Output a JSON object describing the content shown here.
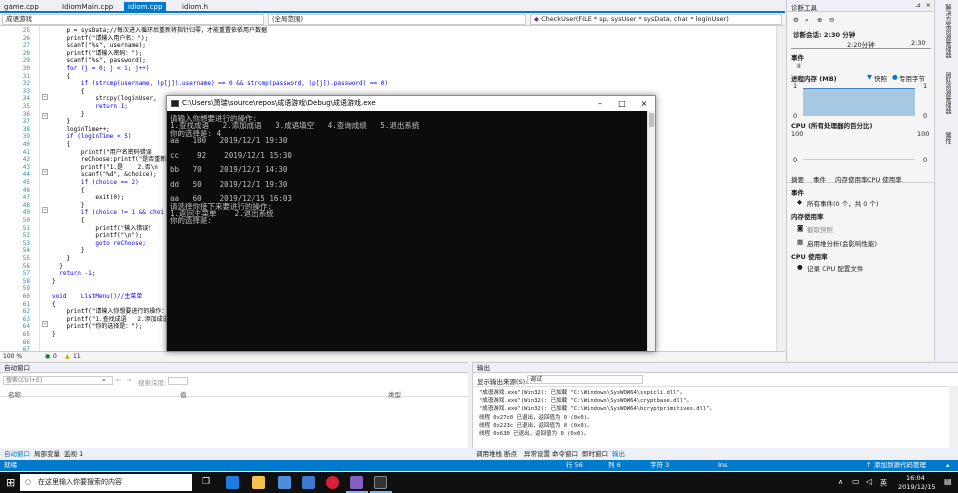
{
  "tabs": [
    {
      "label": "game.cpp"
    },
    {
      "label": "IdiomMain.cpp"
    },
    {
      "label": "idiom.cpp",
      "active": true
    },
    {
      "label": "idiom.h"
    }
  ],
  "nav": {
    "project": "成语游戏",
    "scope": "(全局范围)",
    "function": "CheckUser(FILE * sp, sysUser * sysData, char * loginUser)"
  },
  "editor": {
    "line_numbers": [
      "25",
      "26",
      "27",
      "28",
      "29",
      "30",
      "31",
      "32",
      "33",
      "34",
      "35",
      "36",
      "37",
      "38",
      "39",
      "40",
      "41",
      "42",
      "43",
      "44",
      "45",
      "46",
      "47",
      "48",
      "49",
      "50",
      "51",
      "52",
      "53",
      "54",
      "55",
      "56",
      "57",
      "58",
      "59",
      "60",
      "61",
      "62",
      "63",
      "64",
      "65",
      "66",
      "67"
    ],
    "lines": [
      "    p = sysData;//每次进入循环后重新将指针归零，才能重置依依用户数据",
      "    printf(\"请输入用户名：\");",
      "    scanf(\"%s\", username);",
      "    printf(\"请输入密码：\");",
      "    scanf(\"%s\", password);",
      "    for (j = 0; j < i; j++)",
      "    {",
      "        if (strcmp(username, (p[j]).username) == 0 && strcmp(password, (p[j]).password) == 0)",
      "        {",
      "            strcpy(loginUser,",
      "            return 1;",
      "        }",
      "    }",
      "    loginTime++;",
      "    if (loginTime < 5)",
      "    {",
      "        printf(\"用户名密码错误",
      "        reChoose:printf(\"是否重新",
      "        printf(\"1.是    2.否\\n",
      "        scanf(\"%d\", &choice);",
      "        if (choice == 2)",
      "        {",
      "            exit(0);",
      "        }",
      "        if (choice != 1 && choi",
      "        {",
      "            printf(\"输入错误！",
      "            printf(\"\\n\");",
      "            goto reChoose;",
      "        }",
      "    }",
      "  }",
      "  return -1;",
      "}",
      "",
      "void    ListMenu()//主菜单",
      "{",
      "    printf(\"请输入你想要进行的操作：",
      "    printf(\"1.查找成语   2.添加成语",
      "    printf(\"你的选择是：\");",
      "}",
      "",
      ""
    ],
    "zoom": "100 %",
    "errors": "0",
    "warnings": "11"
  },
  "console": {
    "title": "C:\\Users\\萧瑞\\source\\repos\\成语游戏\\Debug\\成语游戏.exe",
    "lines": [
      "请输入你想要进行的操作:",
      "1.查找成语   2.添加成语   3.成语填空   4.查询成绩   5.退出系统",
      "你的选择是: 4",
      "aa   100   2019/12/1 19:30",
      "",
      "cc    92    2019/12/1 15:30",
      "",
      "bb   70    2019/12/1 14:30",
      "",
      "dd   50    2019/12/1 19:30",
      "",
      "aa   60    2019/12/15 16:03",
      "请选择你接下来要进行的操作:",
      "1.返回主菜单    2.退出系统",
      "你的选择是:"
    ]
  },
  "diagnostics": {
    "title": "诊断工具",
    "session": "诊断会话: 2:30 分钟",
    "time_left": "2:20分钟",
    "time_right": "2:30",
    "events_label": "事件",
    "events_marker": "II",
    "memory_label": "进程内存 (MB)",
    "legend_snapshot": "快照",
    "legend_private": "专用字节",
    "mem_top_left": "1",
    "mem_top_right": "1",
    "mem_bottom_left": "0",
    "mem_bottom_right": "0",
    "cpu_label": "CPU (所有处理器的百分比)",
    "cpu_top_left": "100",
    "cpu_top_right": "100",
    "cpu_bottom_left": "0",
    "cpu_bottom_right": "0",
    "subtabs": [
      "摘要",
      "事件",
      "内存使用率",
      "CPU 使用率"
    ],
    "events_section": "事件",
    "events_all": "所有事件(0 个，共 0 个)",
    "mem_section": "内存使用率",
    "take_snapshot": "截取快照",
    "heap_profile": "启用堆分析(会影响性能)",
    "cpu_section": "CPU 使用率",
    "record_cpu": "记录 CPU 配置文件"
  },
  "vertical_tabs": [
    "解决方案资源管理器",
    "团队资源管理器",
    "属性"
  ],
  "autos": {
    "title": "自动窗口",
    "search_placeholder": "搜索(Ctrl+E)",
    "search_depth": "搜索深度:",
    "col_name": "名称",
    "col_value": "值",
    "col_type": "类型"
  },
  "output": {
    "title": "输出",
    "source_label": "显示输出来源(S):",
    "source_value": "调试",
    "lines": [
      "\"成语游戏.exe\"(Win32): 已加载 \"C:\\Windows\\SysWOW64\\sspicli.dll\"。",
      "\"成语游戏.exe\"(Win32): 已加载 \"C:\\Windows\\SysWOW64\\cryptbase.dll\"。",
      "\"成语游戏.exe\"(Win32): 已加载 \"C:\\Windows\\SysWOW64\\bcryptprimitives.dll\"。",
      "线程 0x27c0 已退出，返回值为 0 (0x0)。",
      "线程 0x223c 已退出，返回值为 0 (0x0)。",
      "线程 0x630 已退出，返回值为 0 (0x0)。"
    ]
  },
  "bottom_tabs_left": [
    "自动窗口",
    "局部变量",
    "监视 1"
  ],
  "bottom_tabs_right": [
    "调用堆栈",
    "断点",
    "异常设置",
    "命令窗口",
    "即时窗口",
    "输出"
  ],
  "status": {
    "left": "就绪",
    "line": "行 56",
    "col": "列 6",
    "char": "字符 3",
    "mode": "Ins",
    "source_control": "添加到源代码管理"
  },
  "taskbar": {
    "search_placeholder": "在这里输入你要搜索的内容",
    "time": "16:04",
    "date": "2019/12/15",
    "lang": "英"
  },
  "colors": {
    "accent": "#007acc",
    "console_bg": "#0c0c0c",
    "taskbar": "#101010"
  }
}
